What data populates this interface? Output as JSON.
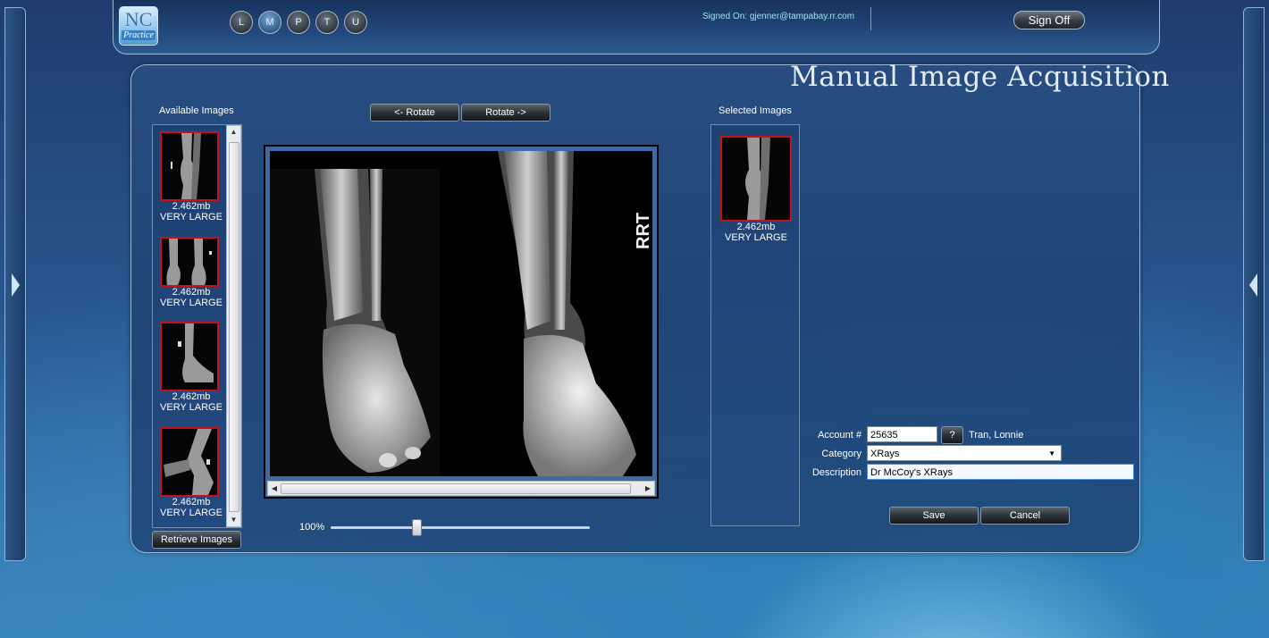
{
  "app": {
    "logo_text": "NC",
    "logo_subtext": "Practice",
    "nav_buttons": [
      "L",
      "M",
      "P",
      "T",
      "U"
    ],
    "signed_on": "Signed On: gjenner@tampabay.rr.com",
    "sign_off_label": "Sign Off"
  },
  "page": {
    "title": "Manual Image Acquisition"
  },
  "available": {
    "label": "Available Images",
    "images": [
      {
        "size": "2.462mb",
        "class": "VERY LARGE"
      },
      {
        "size": "2.462mb",
        "class": "VERY LARGE"
      },
      {
        "size": "2.462mb",
        "class": "VERY LARGE"
      },
      {
        "size": "2.462mb",
        "class": "VERY LARGE"
      }
    ],
    "retrieve_label": "Retrieve Images"
  },
  "viewer": {
    "rotate_left_label": "<- Rotate",
    "rotate_right_label": "Rotate ->",
    "zoom_text": "100%",
    "zoom_level": 0.33,
    "marker_text": "RRT"
  },
  "selected": {
    "label": "Selected Images",
    "images": [
      {
        "size": "2.462mb",
        "class": "VERY LARGE"
      }
    ]
  },
  "form": {
    "account_label": "Account #",
    "account_value": "25635",
    "lookup_label": "?",
    "patient_name": "Tran, Lonnie",
    "category_label": "Category",
    "category_value": "XRays",
    "description_label": "Description",
    "description_value": "Dr McCoy's XRays",
    "save_label": "Save",
    "cancel_label": "Cancel"
  }
}
